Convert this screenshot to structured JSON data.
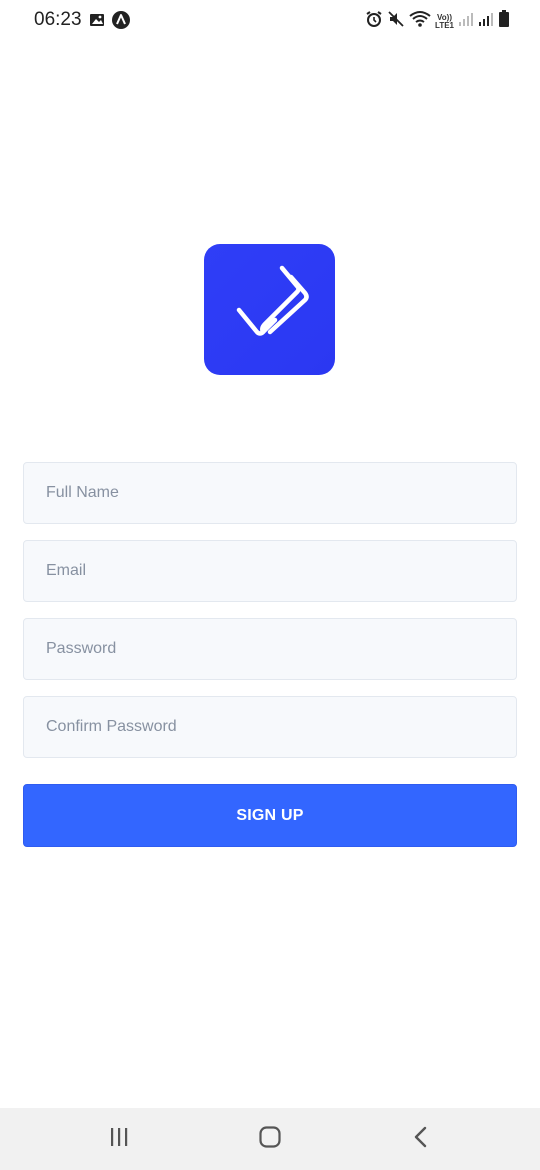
{
  "status_bar": {
    "time": "06:23",
    "left_icons": [
      "image-icon",
      "app-notification-icon"
    ],
    "right_icons": [
      "alarm-icon",
      "mute-icon",
      "wifi-icon",
      "volte-lte-icon",
      "signal-icon",
      "signal-icon",
      "battery-icon"
    ],
    "volte_top": "Vo))",
    "volte_bottom": "LTE1"
  },
  "logo": {
    "icon": "app-logo-icon",
    "color": "#2f3ef7"
  },
  "form": {
    "full_name": {
      "value": "",
      "placeholder": "Full Name"
    },
    "email": {
      "value": "",
      "placeholder": "Email"
    },
    "password": {
      "value": "",
      "placeholder": "Password"
    },
    "confirm_password": {
      "value": "",
      "placeholder": "Confirm Password"
    },
    "submit_label": "SIGN UP",
    "accent_color": "#3366ff"
  },
  "nav_bar": {
    "buttons": [
      "recent-apps-icon",
      "home-icon",
      "back-icon"
    ]
  }
}
